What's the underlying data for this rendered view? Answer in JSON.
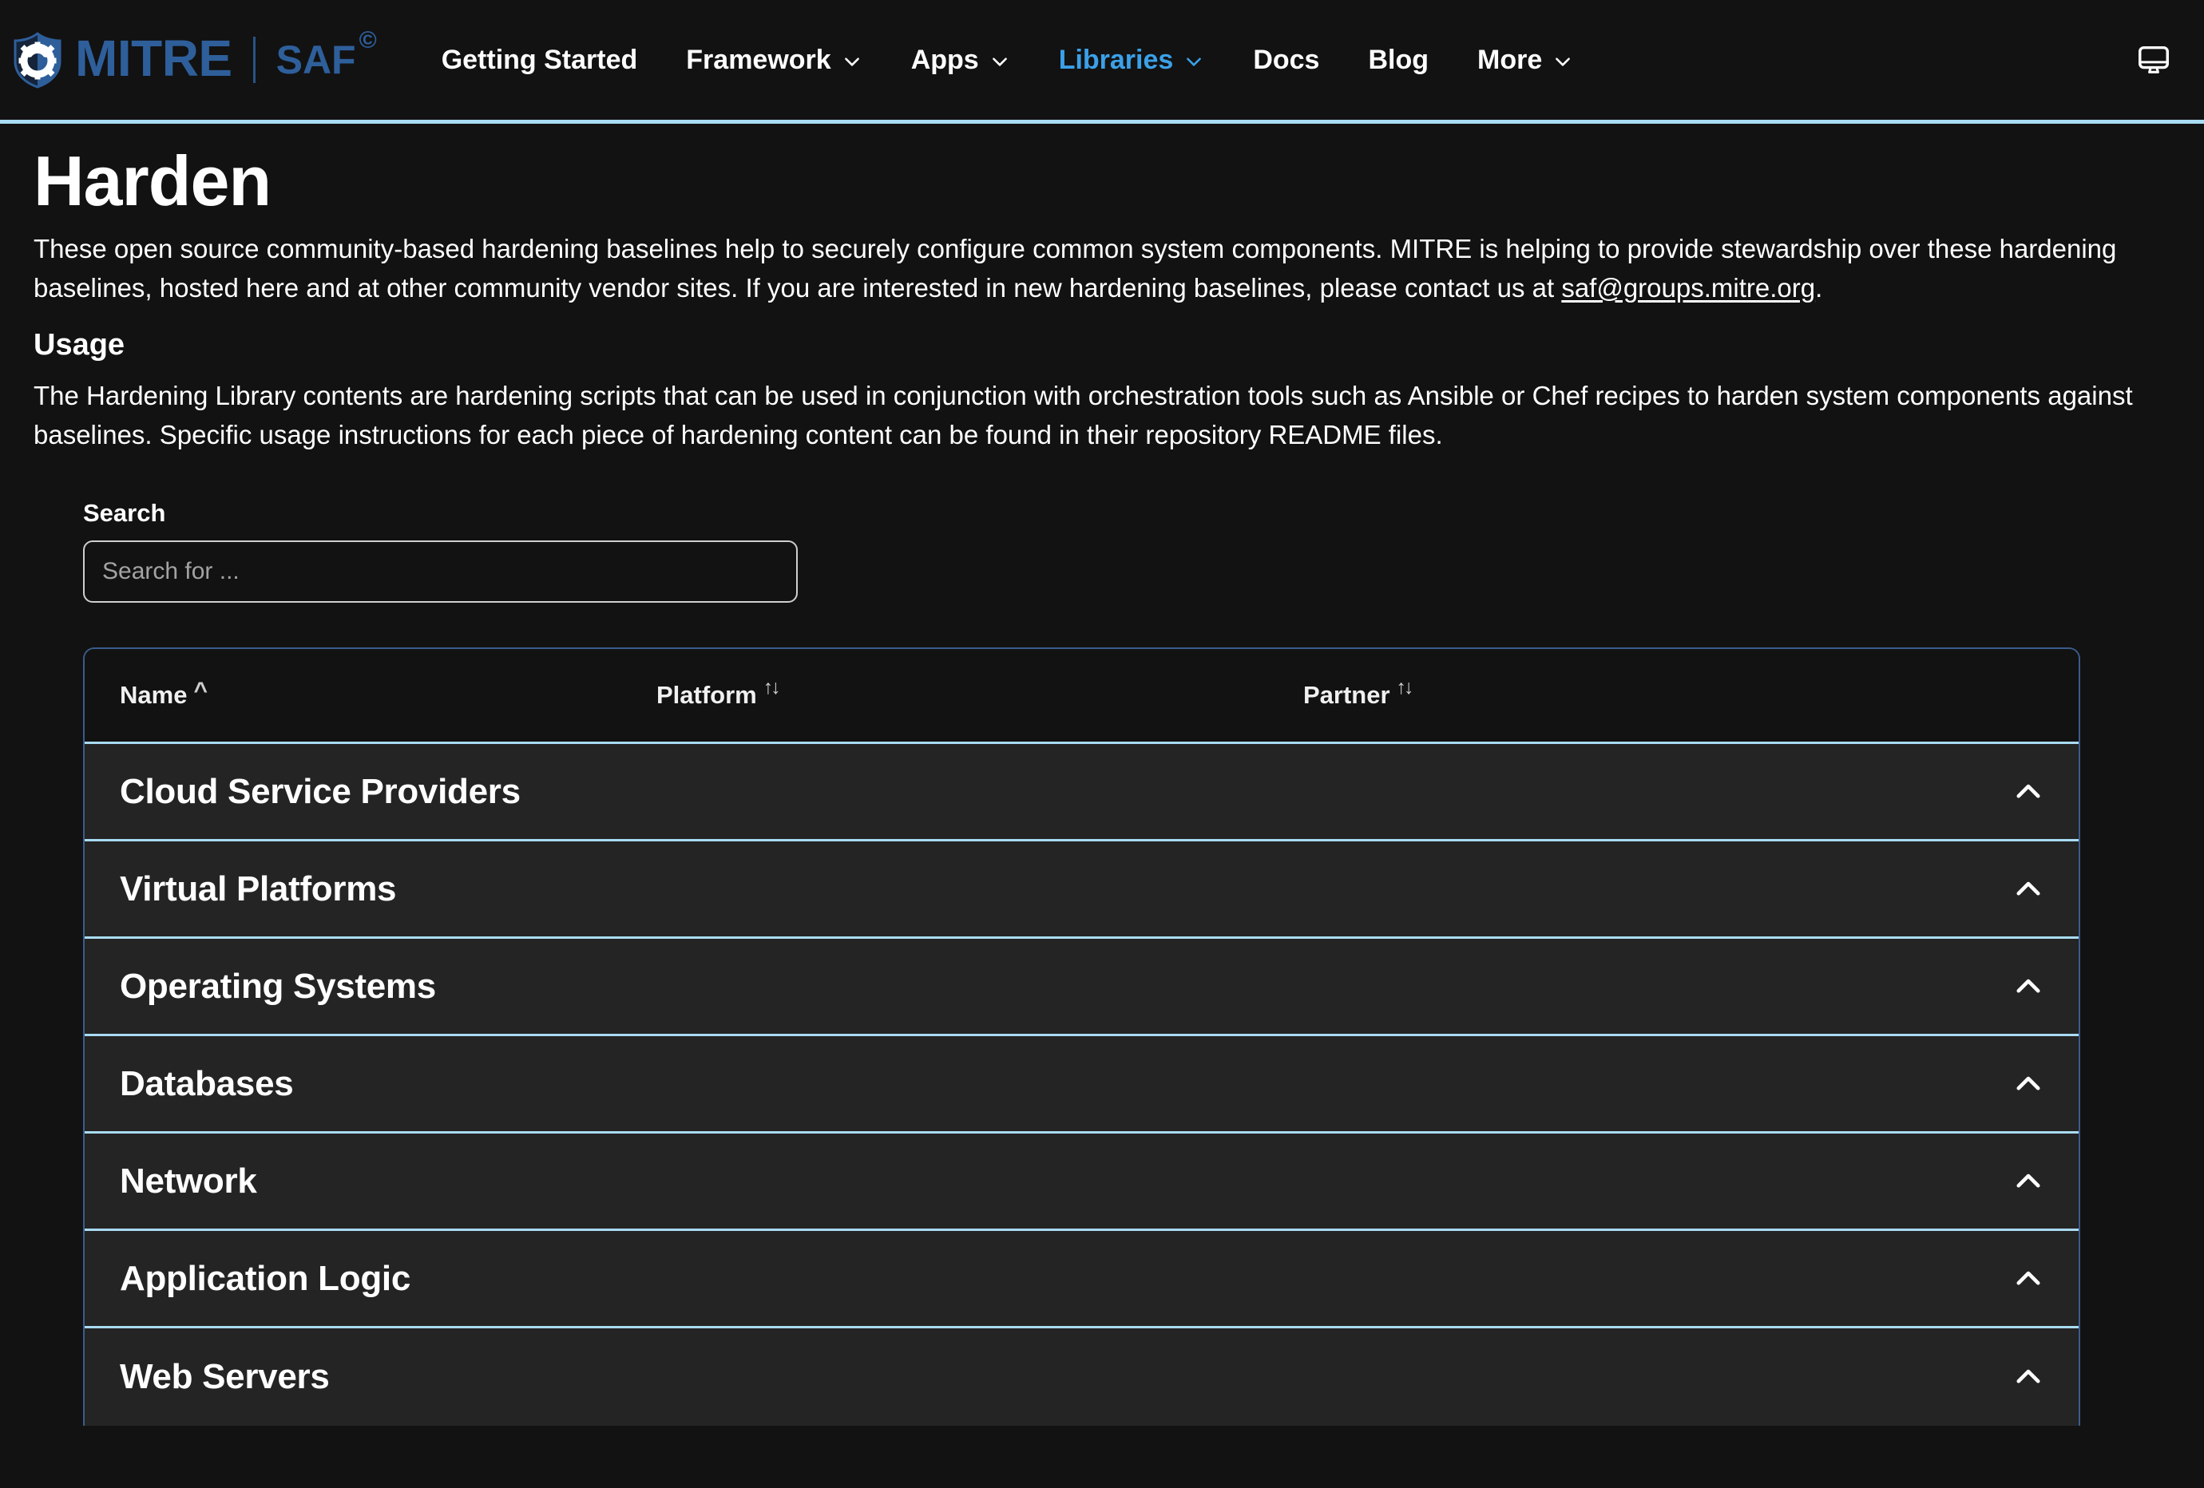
{
  "navbar": {
    "brand": {
      "logo_icon": "mitre-shield-gear-icon",
      "mitre": "MITRE",
      "saf": "SAF",
      "copyright": "©"
    },
    "links": [
      {
        "label": "Getting Started",
        "has_caret": false,
        "active": false
      },
      {
        "label": "Framework",
        "has_caret": true,
        "active": false
      },
      {
        "label": "Apps",
        "has_caret": true,
        "active": false
      },
      {
        "label": "Libraries",
        "has_caret": true,
        "active": true
      },
      {
        "label": "Docs",
        "has_caret": false,
        "active": false
      },
      {
        "label": "Blog",
        "has_caret": false,
        "active": false
      },
      {
        "label": "More",
        "has_caret": true,
        "active": false
      }
    ],
    "theme_toggle_icon": "desktop-monitor-icon",
    "accent_border": "#a9dcf4",
    "brand_color": "#2e5f9b",
    "active_link_color": "#3ba0e8"
  },
  "page": {
    "title": "Harden",
    "intro_part1": "These open source community-based hardening baselines help to securely configure common system components. MITRE is helping to provide stewardship over these hardening baselines, hosted here and at other community vendor sites. If you are interested in new hardening baselines, please contact us at ",
    "intro_link": "saf@groups.mitre.org",
    "intro_part2": ".",
    "usage_heading": "Usage",
    "usage_text": "The Hardening Library contents are hardening scripts that can be used in conjunction with orchestration tools such as Ansible or Chef recipes to harden system components against baselines. Specific usage instructions for each piece of hardening content can be found in their repository README files."
  },
  "search": {
    "label": "Search",
    "value": "",
    "placeholder": "Search for ..."
  },
  "table": {
    "columns": [
      {
        "label": "Name",
        "sort_icon": "sort-ascending-icon",
        "sort_glyph": "^",
        "sorted": true
      },
      {
        "label": "Platform",
        "sort_icon": "sort-both-icon",
        "sort_glyph": "↑↓",
        "sorted": false
      },
      {
        "label": "Partner",
        "sort_icon": "sort-both-icon",
        "sort_glyph": "↑↓",
        "sorted": false
      }
    ],
    "rows": [
      {
        "name": "Cloud Service Providers",
        "chevron": "chevron-up-icon",
        "expanded": true
      },
      {
        "name": "Virtual Platforms",
        "chevron": "chevron-up-icon",
        "expanded": true
      },
      {
        "name": "Operating Systems",
        "chevron": "chevron-up-icon",
        "expanded": true
      },
      {
        "name": "Databases",
        "chevron": "chevron-up-icon",
        "expanded": true
      },
      {
        "name": "Network",
        "chevron": "chevron-up-icon",
        "expanded": true
      },
      {
        "name": "Application Logic",
        "chevron": "chevron-up-icon",
        "expanded": true
      },
      {
        "name": "Web Servers",
        "chevron": "chevron-up-icon",
        "expanded": true
      }
    ],
    "row_bg": "#242424",
    "divider_color": "#a9dcf4",
    "border_color": "#3b5c8c"
  }
}
